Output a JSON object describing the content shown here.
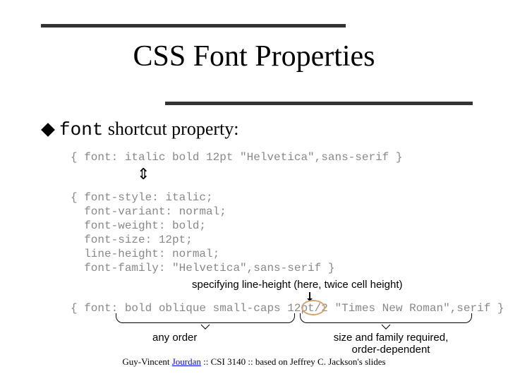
{
  "title": "CSS Font Properties",
  "bullet": {
    "code": "font",
    "rest": " shortcut property:"
  },
  "code_short": "{ font: italic bold 12pt \"Helvetica\",sans-serif }",
  "code_long": "{ font-style: italic;\n  font-variant: normal;\n  font-weight: bold;\n  font-size: 12pt;\n  line-height: normal;\n  font-family: \"Helvetica\",sans-serif }",
  "code_ext": "{ font: bold oblique small-caps 12pt/2 \"Times New Roman\",serif }",
  "ann": {
    "line_height": "specifying line-height (here, twice cell height)",
    "any_order": "any order",
    "required": "size and family required, order-dependent"
  },
  "footer": {
    "pre": "Guy-Vincent ",
    "link": "Jourdan",
    "post": " :: CSI 3140 :: based on Jeffrey C. Jackson's slides"
  },
  "glyphs": {
    "down_up": "⇕"
  }
}
